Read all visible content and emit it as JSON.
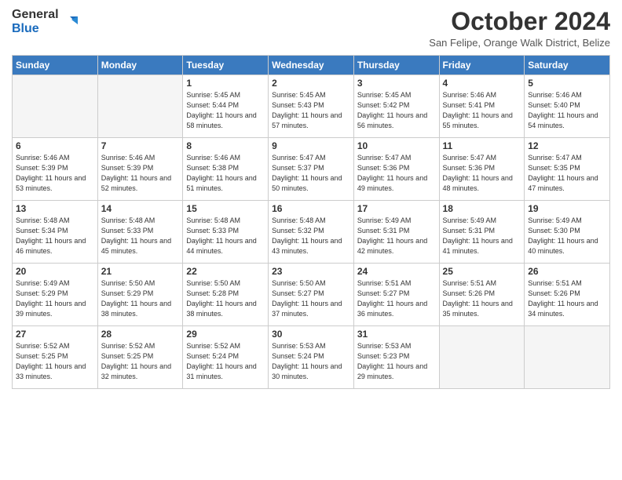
{
  "logo": {
    "line1": "General",
    "line2": "Blue"
  },
  "title": "October 2024",
  "subtitle": "San Felipe, Orange Walk District, Belize",
  "headers": [
    "Sunday",
    "Monday",
    "Tuesday",
    "Wednesday",
    "Thursday",
    "Friday",
    "Saturday"
  ],
  "weeks": [
    [
      {
        "day": "",
        "info": ""
      },
      {
        "day": "",
        "info": ""
      },
      {
        "day": "1",
        "info": "Sunrise: 5:45 AM\nSunset: 5:44 PM\nDaylight: 11 hours and 58 minutes."
      },
      {
        "day": "2",
        "info": "Sunrise: 5:45 AM\nSunset: 5:43 PM\nDaylight: 11 hours and 57 minutes."
      },
      {
        "day": "3",
        "info": "Sunrise: 5:45 AM\nSunset: 5:42 PM\nDaylight: 11 hours and 56 minutes."
      },
      {
        "day": "4",
        "info": "Sunrise: 5:46 AM\nSunset: 5:41 PM\nDaylight: 11 hours and 55 minutes."
      },
      {
        "day": "5",
        "info": "Sunrise: 5:46 AM\nSunset: 5:40 PM\nDaylight: 11 hours and 54 minutes."
      }
    ],
    [
      {
        "day": "6",
        "info": "Sunrise: 5:46 AM\nSunset: 5:39 PM\nDaylight: 11 hours and 53 minutes."
      },
      {
        "day": "7",
        "info": "Sunrise: 5:46 AM\nSunset: 5:39 PM\nDaylight: 11 hours and 52 minutes."
      },
      {
        "day": "8",
        "info": "Sunrise: 5:46 AM\nSunset: 5:38 PM\nDaylight: 11 hours and 51 minutes."
      },
      {
        "day": "9",
        "info": "Sunrise: 5:47 AM\nSunset: 5:37 PM\nDaylight: 11 hours and 50 minutes."
      },
      {
        "day": "10",
        "info": "Sunrise: 5:47 AM\nSunset: 5:36 PM\nDaylight: 11 hours and 49 minutes."
      },
      {
        "day": "11",
        "info": "Sunrise: 5:47 AM\nSunset: 5:36 PM\nDaylight: 11 hours and 48 minutes."
      },
      {
        "day": "12",
        "info": "Sunrise: 5:47 AM\nSunset: 5:35 PM\nDaylight: 11 hours and 47 minutes."
      }
    ],
    [
      {
        "day": "13",
        "info": "Sunrise: 5:48 AM\nSunset: 5:34 PM\nDaylight: 11 hours and 46 minutes."
      },
      {
        "day": "14",
        "info": "Sunrise: 5:48 AM\nSunset: 5:33 PM\nDaylight: 11 hours and 45 minutes."
      },
      {
        "day": "15",
        "info": "Sunrise: 5:48 AM\nSunset: 5:33 PM\nDaylight: 11 hours and 44 minutes."
      },
      {
        "day": "16",
        "info": "Sunrise: 5:48 AM\nSunset: 5:32 PM\nDaylight: 11 hours and 43 minutes."
      },
      {
        "day": "17",
        "info": "Sunrise: 5:49 AM\nSunset: 5:31 PM\nDaylight: 11 hours and 42 minutes."
      },
      {
        "day": "18",
        "info": "Sunrise: 5:49 AM\nSunset: 5:31 PM\nDaylight: 11 hours and 41 minutes."
      },
      {
        "day": "19",
        "info": "Sunrise: 5:49 AM\nSunset: 5:30 PM\nDaylight: 11 hours and 40 minutes."
      }
    ],
    [
      {
        "day": "20",
        "info": "Sunrise: 5:49 AM\nSunset: 5:29 PM\nDaylight: 11 hours and 39 minutes."
      },
      {
        "day": "21",
        "info": "Sunrise: 5:50 AM\nSunset: 5:29 PM\nDaylight: 11 hours and 38 minutes."
      },
      {
        "day": "22",
        "info": "Sunrise: 5:50 AM\nSunset: 5:28 PM\nDaylight: 11 hours and 38 minutes."
      },
      {
        "day": "23",
        "info": "Sunrise: 5:50 AM\nSunset: 5:27 PM\nDaylight: 11 hours and 37 minutes."
      },
      {
        "day": "24",
        "info": "Sunrise: 5:51 AM\nSunset: 5:27 PM\nDaylight: 11 hours and 36 minutes."
      },
      {
        "day": "25",
        "info": "Sunrise: 5:51 AM\nSunset: 5:26 PM\nDaylight: 11 hours and 35 minutes."
      },
      {
        "day": "26",
        "info": "Sunrise: 5:51 AM\nSunset: 5:26 PM\nDaylight: 11 hours and 34 minutes."
      }
    ],
    [
      {
        "day": "27",
        "info": "Sunrise: 5:52 AM\nSunset: 5:25 PM\nDaylight: 11 hours and 33 minutes."
      },
      {
        "day": "28",
        "info": "Sunrise: 5:52 AM\nSunset: 5:25 PM\nDaylight: 11 hours and 32 minutes."
      },
      {
        "day": "29",
        "info": "Sunrise: 5:52 AM\nSunset: 5:24 PM\nDaylight: 11 hours and 31 minutes."
      },
      {
        "day": "30",
        "info": "Sunrise: 5:53 AM\nSunset: 5:24 PM\nDaylight: 11 hours and 30 minutes."
      },
      {
        "day": "31",
        "info": "Sunrise: 5:53 AM\nSunset: 5:23 PM\nDaylight: 11 hours and 29 minutes."
      },
      {
        "day": "",
        "info": ""
      },
      {
        "day": "",
        "info": ""
      }
    ]
  ]
}
